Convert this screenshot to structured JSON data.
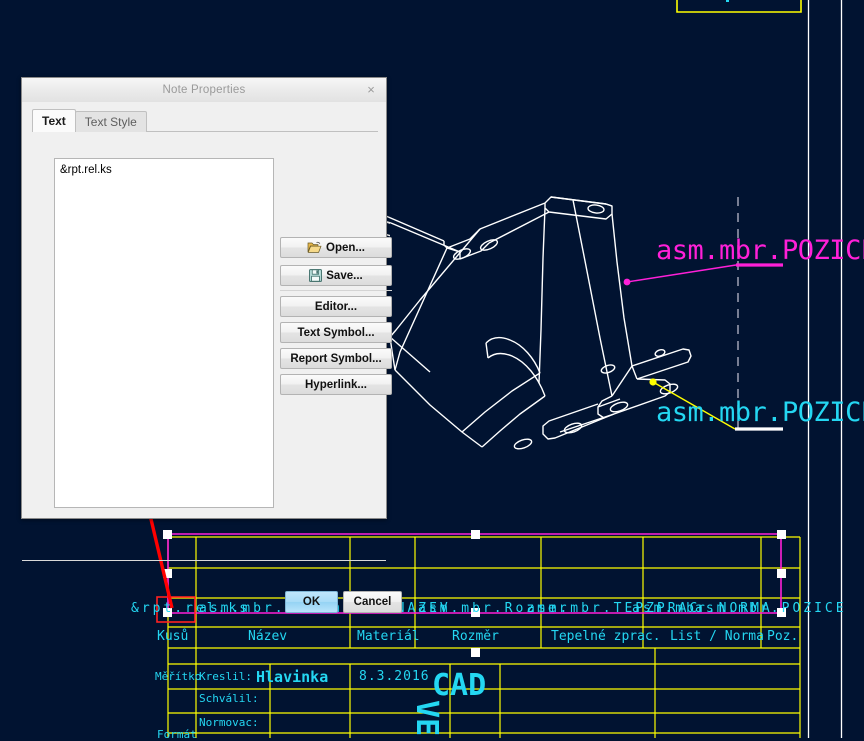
{
  "app": {
    "background_color": "#011331",
    "accent_cyan": "#24d7f2",
    "accent_magenta": "#ff20d8",
    "accent_yellow": "#ffff00",
    "arrow_color": "#ff0000"
  },
  "dialog": {
    "title": "Note Properties",
    "close_label": "×",
    "tabs": [
      {
        "label": "Text",
        "active": true
      },
      {
        "label": "Text Style",
        "active": false
      }
    ],
    "text_value": "&rpt.rel.ks",
    "text_placeholder": "",
    "buttons": {
      "open": "Open...",
      "save": "Save...",
      "editor": "Editor...",
      "text_symbol": "Text Symbol...",
      "report_symbol": "Report Symbol...",
      "hyperlink": "Hyperlink..."
    },
    "footer": {
      "ok": "OK",
      "cancel": "Cancel"
    }
  },
  "drawing": {
    "annotations": [
      {
        "text": "asm.mbr.POZICE",
        "color": "#ff20d8"
      },
      {
        "text": "asm.mbr.POZICE",
        "color": "#24d7f2"
      }
    ],
    "title_block": {
      "parameter_row": [
        "&rpt.rel.ks",
        "asm.mbr.NAZEV",
        "asm.mbr.NAZEV",
        "asm.mbr.Rozmer",
        "asm.mbr.TEPZPRAC",
        "asm.mbr.NORMA",
        "asm.mbr.POZICE"
      ],
      "header_row": [
        "Kusů",
        "Název",
        "Materiál",
        "Rozměr",
        "Tepelné zprac.",
        "List / Norma",
        "Poz."
      ],
      "lower_rows": [
        {
          "label": "Měřítko",
          "field": "Kreslil:",
          "name": "Hlavinka",
          "date": "8.3.2016"
        },
        {
          "label": "",
          "field": "Schválil:",
          "name": "",
          "date": ""
        },
        {
          "label": "",
          "field": "Normovac:",
          "name": "",
          "date": ""
        },
        {
          "label": "Formát",
          "field": "",
          "name": "",
          "date": ""
        }
      ],
      "stamp_lines": [
        "CAD",
        "VE"
      ]
    }
  }
}
